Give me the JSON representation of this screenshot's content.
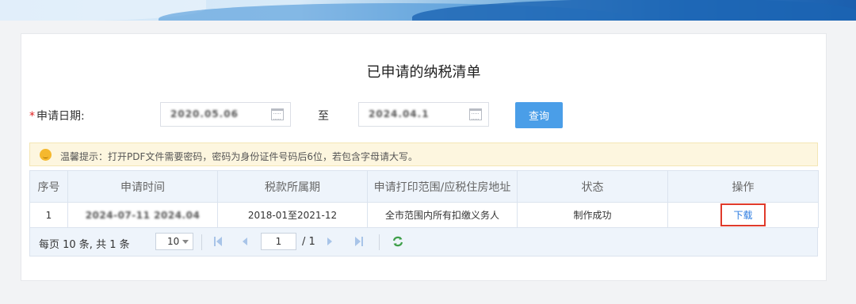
{
  "page": {
    "title": "已申请的纳税清单"
  },
  "filter": {
    "required_mark": "*",
    "date_label": "申请日期:",
    "start_date": "2020.05.06",
    "to_label": "至",
    "end_date": "2024.04.1",
    "query_button": "查询"
  },
  "tip": {
    "text": "温馨提示：打开PDF文件需要密码，密码为身份证件号码后6位，若包含字母请大写。"
  },
  "table": {
    "headers": [
      "序号",
      "申请时间",
      "税款所属期",
      "申请打印范围/应税住房地址",
      "状态",
      "操作"
    ],
    "rows": [
      {
        "index": "1",
        "apply_time": "2024-07-11 2024.04",
        "period": "2018-01至2021-12",
        "scope": "全市范围内所有扣缴义务人",
        "status": "制作成功",
        "action": "下载"
      }
    ]
  },
  "pager": {
    "summary": "每页 10 条, 共 1 条",
    "page_size": "10",
    "current_page": "1",
    "total_pages": "/ 1"
  },
  "colors": {
    "accent": "#4a9ee8",
    "highlight_box": "#e03a2b",
    "link": "#2d7ce0"
  },
  "icons": [
    "calendar-icon",
    "tip-icon",
    "first-page-icon",
    "prev-page-icon",
    "next-page-icon",
    "last-page-icon",
    "refresh-icon"
  ]
}
